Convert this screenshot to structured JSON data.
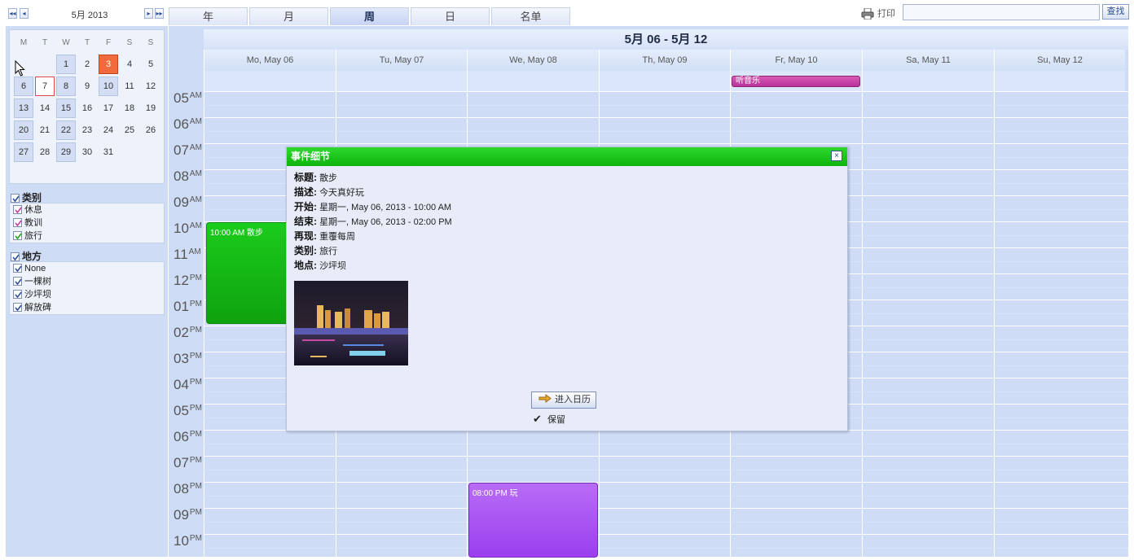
{
  "mini_calendar": {
    "month_label": "5月 2013",
    "weekdays": [
      "M",
      "T",
      "W",
      "T",
      "F",
      "S",
      "S"
    ],
    "weeks": [
      [
        "",
        "",
        "1",
        "2",
        "3",
        "4",
        "5"
      ],
      [
        "6",
        "7",
        "8",
        "9",
        "10",
        "11",
        "12"
      ],
      [
        "13",
        "14",
        "15",
        "16",
        "17",
        "18",
        "19"
      ],
      [
        "20",
        "21",
        "22",
        "23",
        "24",
        "25",
        "26"
      ],
      [
        "27",
        "28",
        "29",
        "30",
        "31",
        "",
        ""
      ]
    ],
    "selected_day": "3",
    "today_day": "7",
    "event_days": [
      "1",
      "6",
      "8",
      "10",
      "13",
      "15",
      "20",
      "22",
      "27",
      "29"
    ]
  },
  "view_tabs": [
    {
      "label": "年",
      "active": false
    },
    {
      "label": "月",
      "active": false
    },
    {
      "label": "周",
      "active": true
    },
    {
      "label": "日",
      "active": false
    },
    {
      "label": "名单",
      "active": false
    }
  ],
  "toolbar": {
    "print_label": "打印",
    "search_placeholder": "",
    "search_button": "查找"
  },
  "categories": {
    "title": "类别",
    "items": [
      {
        "label": "休息",
        "color": "#c8399a"
      },
      {
        "label": "教训",
        "color": "#c8399a"
      },
      {
        "label": "旅行",
        "color": "#13a913"
      }
    ]
  },
  "places": {
    "title": "地方",
    "items": [
      {
        "label": "None"
      },
      {
        "label": "一棵树"
      },
      {
        "label": "沙坪坝"
      },
      {
        "label": "解放碑"
      }
    ]
  },
  "week": {
    "title": "5月 06 - 5月 12",
    "days": [
      "Mo, May 06",
      "Tu, May 07",
      "We, May 08",
      "Th, May 09",
      "Fr, May 10",
      "Sa, May 11",
      "Su, May 12"
    ],
    "hours": [
      {
        "h": "05",
        "ap": "AM"
      },
      {
        "h": "06",
        "ap": "AM"
      },
      {
        "h": "07",
        "ap": "AM"
      },
      {
        "h": "08",
        "ap": "AM"
      },
      {
        "h": "09",
        "ap": "AM"
      },
      {
        "h": "10",
        "ap": "AM"
      },
      {
        "h": "11",
        "ap": "AM"
      },
      {
        "h": "12",
        "ap": "PM"
      },
      {
        "h": "01",
        "ap": "PM"
      },
      {
        "h": "02",
        "ap": "PM"
      },
      {
        "h": "03",
        "ap": "PM"
      },
      {
        "h": "04",
        "ap": "PM"
      },
      {
        "h": "05",
        "ap": "PM"
      },
      {
        "h": "06",
        "ap": "PM"
      },
      {
        "h": "07",
        "ap": "PM"
      },
      {
        "h": "08",
        "ap": "PM"
      },
      {
        "h": "09",
        "ap": "PM"
      },
      {
        "h": "10",
        "ap": "PM"
      }
    ]
  },
  "events": {
    "walk": "10:00 AM 散步",
    "play": "08:00 PM 玩",
    "music": "听音乐"
  },
  "popup": {
    "title": "事件细节",
    "close": "×",
    "rows": [
      {
        "label": "标题:",
        "value": "散步"
      },
      {
        "label": "描述:",
        "value": "今天真好玩"
      },
      {
        "label": "开始:",
        "value": "星期一, May 06, 2013 - 10:00 AM"
      },
      {
        "label": "结束:",
        "value": "星期一, May 06, 2013 - 02:00 PM"
      },
      {
        "label": "再现:",
        "value": "重覆每周"
      },
      {
        "label": "类别:",
        "value": "旅行"
      },
      {
        "label": "地点:",
        "value": "沙坪坝"
      }
    ],
    "enter_button": "进入日历",
    "keep_label": "保留"
  }
}
